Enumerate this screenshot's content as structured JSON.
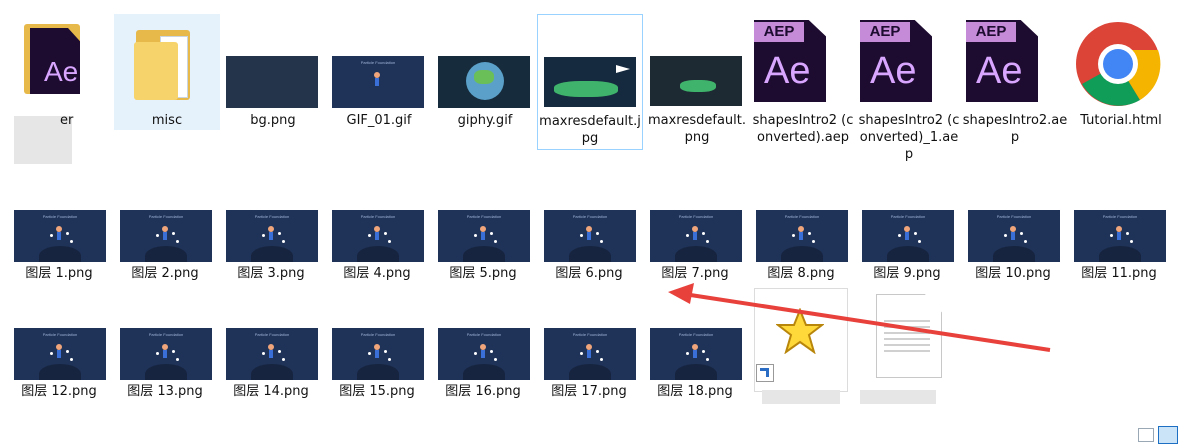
{
  "row1": [
    {
      "label": "er"
    },
    {
      "label": "misc"
    },
    {
      "label": "bg.png"
    },
    {
      "label": "GIF_01.gif"
    },
    {
      "label": "giphy.gif"
    },
    {
      "label": "maxresdefault.jpg"
    },
    {
      "label": "maxresdefault.png"
    },
    {
      "label": "shapesIntro2 (converted).aep"
    },
    {
      "label": "shapesIntro2 (converted)_1.aep"
    },
    {
      "label": "shapesIntro2.aep"
    },
    {
      "label": "Tutorial.html"
    }
  ],
  "row2": [
    "图层 1.png",
    "图层 2.png",
    "图层 3.png",
    "图层 4.png",
    "图层 5.png",
    "图层 6.png",
    "图层 7.png",
    "图层 8.png",
    "图层 9.png",
    "图层 10.png",
    "图层 11.png"
  ],
  "row3": [
    "图层 12.png",
    "图层 13.png",
    "图层 14.png",
    "图层 15.png",
    "图层 16.png",
    "图层 17.png",
    "图层 18.png"
  ],
  "thumb_title": "Particle Foundation",
  "ae_tag": "AEP",
  "ae_letters": "Ae",
  "annotation_color": "#e8413c"
}
